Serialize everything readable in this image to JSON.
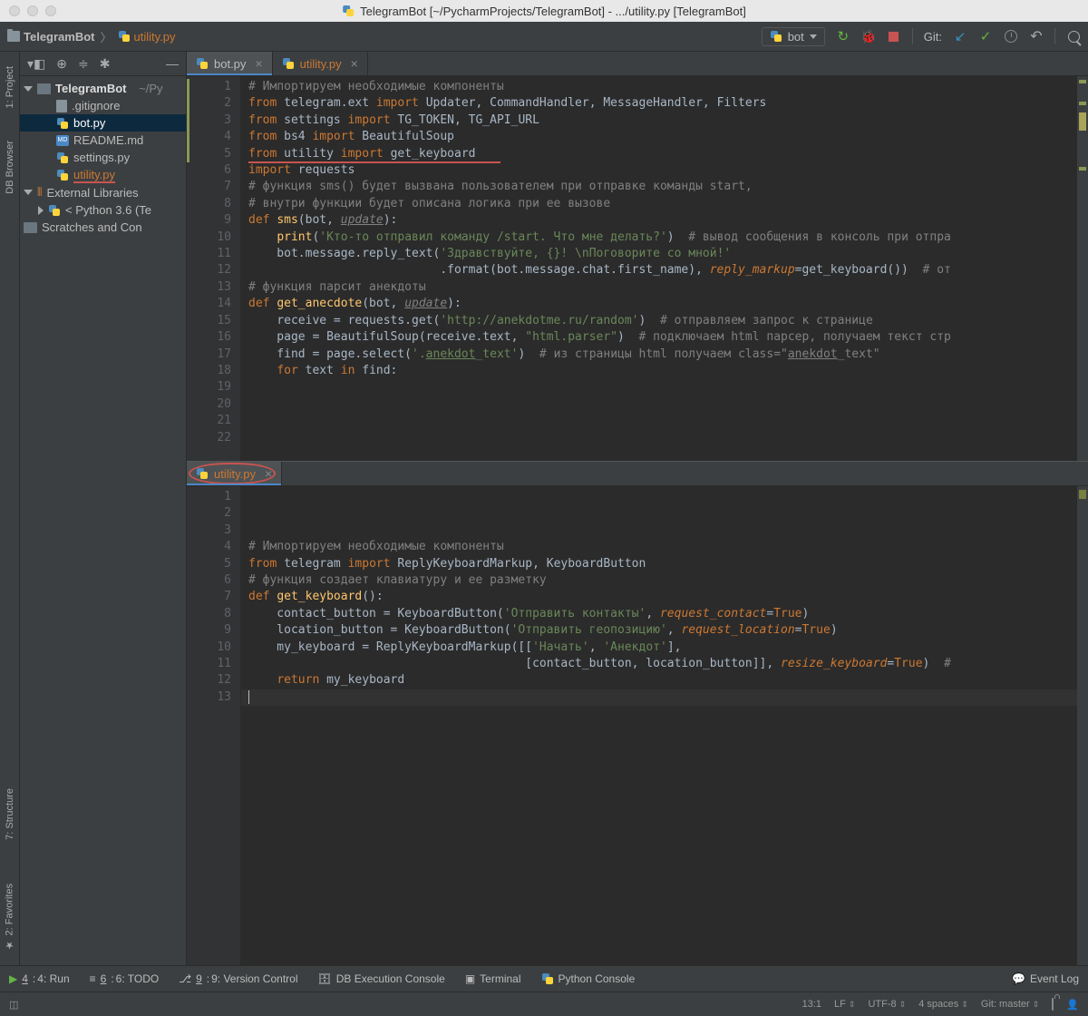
{
  "title": "TelegramBot [~/PycharmProjects/TelegramBot] - .../utility.py [TelegramBot]",
  "crumbs": {
    "root": "TelegramBot",
    "file": "utility.py"
  },
  "run_config": "bot",
  "git_label": "Git:",
  "sidetabs": {
    "project": "1: Project",
    "db": "DB Browser",
    "structure": "7: Structure",
    "favorites": "2: Favorites"
  },
  "tree": {
    "root": "TelegramBot",
    "root_path": "~/Py",
    "gitignore": ".gitignore",
    "bot": "bot.py",
    "readme": "README.md",
    "settings": "settings.py",
    "utility": "utility.py",
    "ext": "External Libraries",
    "python": "< Python 3.6 (Te",
    "scratches": "Scratches and Con"
  },
  "tabs": {
    "bot": "bot.py",
    "utility_top": "utility.py",
    "utility_bottom": "utility.py"
  },
  "gutter_top": [
    "1",
    "2",
    "3",
    "4",
    "5",
    "6",
    "7",
    "8",
    "9",
    "10",
    "11",
    "12",
    "13",
    "14",
    "15",
    "16",
    "17",
    "18",
    "19",
    "20",
    "21",
    "22"
  ],
  "gutter_bot": [
    "1",
    "2",
    "3",
    "4",
    "5",
    "6",
    "7",
    "8",
    "9",
    "10",
    "11",
    "12",
    "13"
  ],
  "bottom": {
    "run": "4: Run",
    "todo": "6: TODO",
    "vcs": "9: Version Control",
    "db": "DB Execution Console",
    "term": "Terminal",
    "pycon": "Python Console",
    "log": "Event Log"
  },
  "status": {
    "pos": "13:1",
    "le": "LF",
    "enc": "UTF-8",
    "indent": "4 spaces",
    "git": "Git: master"
  },
  "code_top": [
    [
      [
        "cm",
        "# Импортируем необходимые компоненты"
      ]
    ],
    [
      [
        "k",
        "from "
      ],
      [
        "nm",
        "telegram.ext "
      ],
      [
        "k",
        "import "
      ],
      [
        "nm",
        "Updater, CommandHandler, MessageHandler, Filters"
      ]
    ],
    [
      [
        "k",
        "from "
      ],
      [
        "nm",
        "settings "
      ],
      [
        "k",
        "import "
      ],
      [
        "nm",
        "TG_TOKEN, TG_API_URL"
      ]
    ],
    [
      [
        "k",
        "from "
      ],
      [
        "nm",
        "bs4 "
      ],
      [
        "k",
        "import "
      ],
      [
        "nm",
        "BeautifulSoup"
      ]
    ],
    [
      [
        "k",
        "from "
      ],
      [
        "nm",
        "utility "
      ],
      [
        "k",
        "import "
      ],
      [
        "nm",
        "get_keyboard"
      ]
    ],
    [
      [
        "k",
        "import "
      ],
      [
        "nm",
        "requests"
      ]
    ],
    [
      [
        "nm",
        ""
      ]
    ],
    [
      [
        "nm",
        ""
      ]
    ],
    [
      [
        "cm",
        "# функция sms() будет вызвана пользователем при отправке команды start,"
      ]
    ],
    [
      [
        "cm",
        "# внутри функции будет описана логика при ее вызове"
      ]
    ],
    [
      [
        "k",
        "def "
      ],
      [
        "fn",
        "sms"
      ],
      [
        "nm",
        "(bot, "
      ],
      [
        "pa",
        "update"
      ],
      [
        "nm",
        "):"
      ]
    ],
    [
      [
        "nm",
        "    "
      ],
      [
        "fn",
        "print"
      ],
      [
        "nm",
        "("
      ],
      [
        "s",
        "'Кто-то отправил команду /start. Что мне делать?'"
      ],
      [
        "nm",
        ")  "
      ],
      [
        "cm",
        "# вывод сообщения в консоль при отпра"
      ]
    ],
    [
      [
        "nm",
        "    bot.message.reply_text("
      ],
      [
        "s",
        "'Здравствуйте, {}! \\nПоговорите со мной!'"
      ]
    ],
    [
      [
        "nm",
        "                           .format(bot.message.chat.first_name), "
      ],
      [
        "kw",
        "reply_markup"
      ],
      [
        "nm",
        "=get_keyboard())  "
      ],
      [
        "cm",
        "# от"
      ]
    ],
    [
      [
        "nm",
        ""
      ]
    ],
    [
      [
        "nm",
        ""
      ]
    ],
    [
      [
        "cm",
        "# функция парсит анекдоты"
      ]
    ],
    [
      [
        "k",
        "def "
      ],
      [
        "fn",
        "get_anecdote"
      ],
      [
        "nm",
        "(bot, "
      ],
      [
        "pa",
        "update"
      ],
      [
        "nm",
        "):"
      ]
    ],
    [
      [
        "nm",
        "    receive = requests.get("
      ],
      [
        "s",
        "'http://anekdotme.ru/random'"
      ],
      [
        "nm",
        ")  "
      ],
      [
        "cm",
        "# отправляем запрос к странице"
      ]
    ],
    [
      [
        "nm",
        "    page = BeautifulSoup(receive.text, "
      ],
      [
        "s",
        "\"html.parser\""
      ],
      [
        "nm",
        ")  "
      ],
      [
        "cm",
        "# подключаем html парсер, получаем текст стр"
      ]
    ],
    [
      [
        "nm",
        "    find = page.select("
      ],
      [
        "s",
        "'."
      ],
      [
        "ul s",
        "anekdot"
      ],
      [
        "s",
        "_text'"
      ],
      [
        "nm",
        ")  "
      ],
      [
        "cm",
        "# из страницы html получаем class=\""
      ],
      [
        "ul cm",
        "anekdot"
      ],
      [
        "cm",
        "_text\""
      ]
    ],
    [
      [
        "nm",
        "    "
      ],
      [
        "k",
        "for "
      ],
      [
        "nm",
        "text "
      ],
      [
        "k",
        "in "
      ],
      [
        "nm",
        "find:"
      ]
    ]
  ],
  "code_bot": [
    [
      [
        "cm",
        "# Импортируем необходимые компоненты"
      ]
    ],
    [
      [
        "k",
        "from "
      ],
      [
        "nm",
        "telegram "
      ],
      [
        "k",
        "import "
      ],
      [
        "nm",
        "ReplyKeyboardMarkup, KeyboardButton"
      ]
    ],
    [
      [
        "nm",
        ""
      ]
    ],
    [
      [
        "nm",
        ""
      ]
    ],
    [
      [
        "cm",
        "# функция создает клавиатуру и ее разметку"
      ]
    ],
    [
      [
        "k",
        "def "
      ],
      [
        "fn",
        "get_keyboard"
      ],
      [
        "nm",
        "():"
      ]
    ],
    [
      [
        "nm",
        "    contact_button = KeyboardButton("
      ],
      [
        "s",
        "'Отправить контакты'"
      ],
      [
        "nm",
        ", "
      ],
      [
        "kw",
        "request_contact"
      ],
      [
        "nm",
        "="
      ],
      [
        "k",
        "True"
      ],
      [
        "nm",
        ")"
      ]
    ],
    [
      [
        "nm",
        "    location_button = KeyboardButton("
      ],
      [
        "s",
        "'Отправить геопозицию'"
      ],
      [
        "nm",
        ", "
      ],
      [
        "kw",
        "request_location"
      ],
      [
        "nm",
        "="
      ],
      [
        "k",
        "True"
      ],
      [
        "nm",
        ")"
      ]
    ],
    [
      [
        "nm",
        "    my_keyboard = ReplyKeyboardMarkup([["
      ],
      [
        "s",
        "'Начать'"
      ],
      [
        "nm",
        ", "
      ],
      [
        "s",
        "'Анекдот'"
      ],
      [
        "nm",
        "],"
      ]
    ],
    [
      [
        "nm",
        "                                       [contact_button, location_button]], "
      ],
      [
        "kw",
        "resize_keyboard"
      ],
      [
        "nm",
        "="
      ],
      [
        "k",
        "True"
      ],
      [
        "nm",
        ")  "
      ],
      [
        "cm",
        "#"
      ]
    ],
    [
      [
        "nm",
        "    "
      ],
      [
        "k",
        "return "
      ],
      [
        "nm",
        "my_keyboard"
      ]
    ],
    [
      [
        "nm",
        ""
      ]
    ],
    [
      [
        "nm",
        ""
      ]
    ]
  ]
}
